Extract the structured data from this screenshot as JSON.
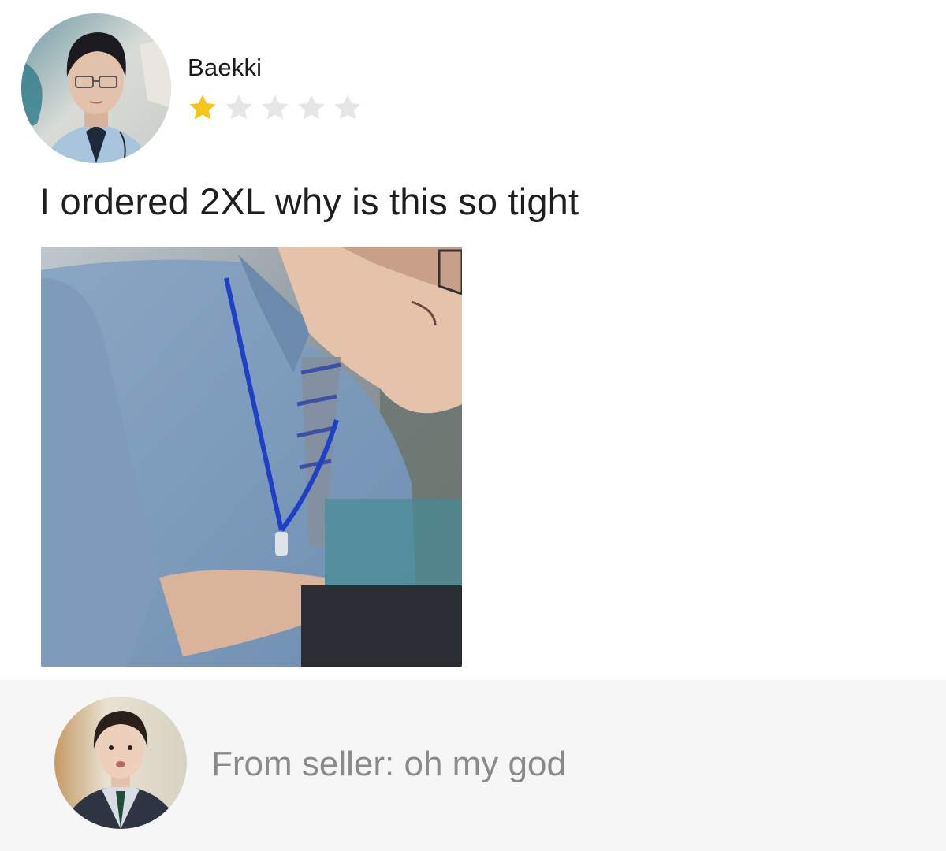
{
  "review": {
    "reviewer_name": "Baekki",
    "rating": 1,
    "max_rating": 5,
    "star_colors": {
      "filled": "#f5c518",
      "empty": "#e6e6e6"
    },
    "text": "I ordered 2XL why is this so tight",
    "photo_icon": "review-photo"
  },
  "seller_reply": {
    "text": "From seller: oh my god",
    "background": "#f6f6f6",
    "text_color": "#8a8a8a"
  }
}
